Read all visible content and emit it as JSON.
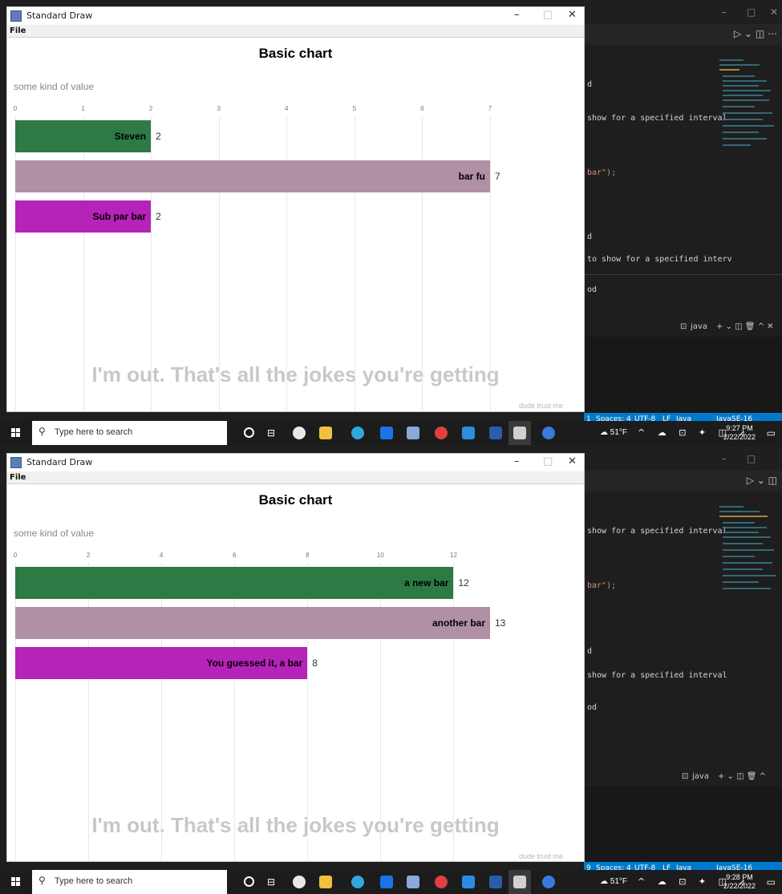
{
  "screenshots": [
    {
      "window": {
        "title": "Standard Draw",
        "minimize": "–",
        "maximize": "□",
        "close": "✕",
        "menu": {
          "file": "File"
        }
      },
      "chart_data": {
        "type": "bar",
        "orientation": "horizontal",
        "title": "Basic chart",
        "xlabel": "some kind of value",
        "xlim": [
          0,
          7
        ],
        "ticks": [
          "0",
          "1",
          "2",
          "3",
          "4",
          "5",
          "6",
          "7"
        ],
        "categories": [
          "Steven",
          "bar fu",
          "Sub par bar"
        ],
        "values": [
          2,
          7,
          2
        ],
        "value_labels": [
          "2",
          "7",
          "2"
        ],
        "colors": [
          "#2d7a45",
          "#b090a5",
          "#b523b8"
        ],
        "caption": "I'm out. That's all the jokes you're getting",
        "source": "dude trust me",
        "grid": true
      },
      "vscode": {
        "code_lines": [
          "d",
          "show for a specified interval",
          "bar\");",
          "d",
          "to show for a specified interv",
          "od"
        ],
        "panel_label": "java",
        "status_items": [
          "1",
          "Spaces: 4",
          "UTF-8",
          "LF",
          "Java",
          "JavaSE-16"
        ]
      },
      "taskbar": {
        "search_placeholder": "Type here to search",
        "weather": "51°F",
        "time": "9:27 PM",
        "date": "2/22/2022"
      }
    },
    {
      "window": {
        "title": "Standard Draw",
        "minimize": "–",
        "maximize": "□",
        "close": "✕",
        "menu": {
          "file": "File"
        }
      },
      "chart_data": {
        "type": "bar",
        "orientation": "horizontal",
        "title": "Basic chart",
        "xlabel": "some kind of value",
        "xlim": [
          0,
          13
        ],
        "ticks": [
          "0",
          "2",
          "4",
          "6",
          "8",
          "10",
          "12"
        ],
        "tick_values": [
          0,
          2,
          4,
          6,
          8,
          10,
          12
        ],
        "categories": [
          "a new bar",
          "another bar",
          "You guessed it, a bar"
        ],
        "values": [
          12,
          13,
          8
        ],
        "value_labels": [
          "12",
          "13",
          "8"
        ],
        "colors": [
          "#2d7a45",
          "#b090a5",
          "#b523b8"
        ],
        "caption": "I'm out. That's all the jokes you're getting",
        "source": "dude trust me",
        "grid": true
      },
      "vscode": {
        "code_lines": [
          "show for a specified interval",
          "bar\");",
          "d",
          "show for a specified interval",
          "od"
        ],
        "panel_label": "java",
        "status_items": [
          "9",
          "Spaces: 4",
          "UTF-8",
          "LF",
          "Java",
          "JavaSE-16"
        ]
      },
      "taskbar": {
        "search_placeholder": "Type here to search",
        "weather": "51°F",
        "time": "9:28 PM",
        "date": "2/22/2022"
      }
    }
  ]
}
